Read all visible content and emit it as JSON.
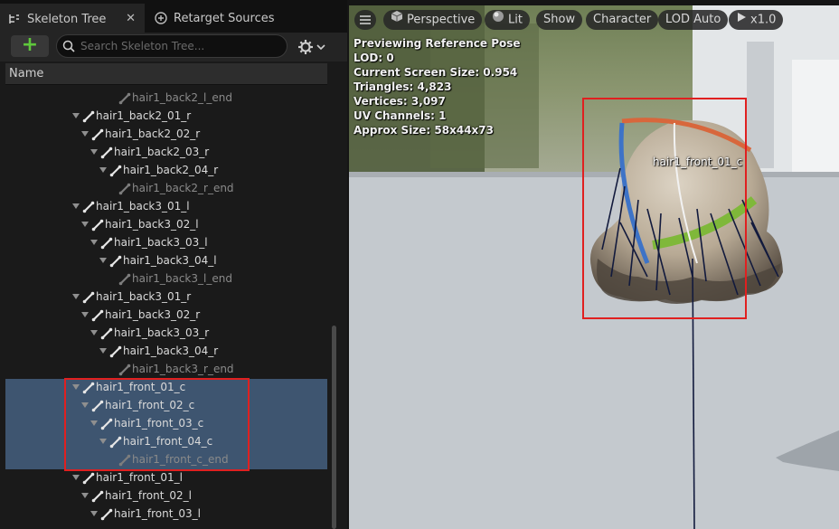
{
  "tabs": [
    {
      "label": "Skeleton Tree",
      "icon": "skeleton-tree-icon",
      "active": true
    },
    {
      "label": "Retarget Sources",
      "icon": "retarget-sources-icon",
      "active": false
    }
  ],
  "toolbar": {
    "add_label": "+",
    "search_placeholder": "Search Skeleton Tree...",
    "search_value": ""
  },
  "tree": {
    "column_header": "Name",
    "rows": [
      {
        "label": "hair1_back2_l_end",
        "depth": 4,
        "leaf": true,
        "selected": false
      },
      {
        "label": "hair1_back2_01_r",
        "depth": 0,
        "leaf": false,
        "selected": false
      },
      {
        "label": "hair1_back2_02_r",
        "depth": 1,
        "leaf": false,
        "selected": false
      },
      {
        "label": "hair1_back2_03_r",
        "depth": 2,
        "leaf": false,
        "selected": false
      },
      {
        "label": "hair1_back2_04_r",
        "depth": 3,
        "leaf": false,
        "selected": false
      },
      {
        "label": "hair1_back2_r_end",
        "depth": 4,
        "leaf": true,
        "selected": false
      },
      {
        "label": "hair1_back3_01_l",
        "depth": 0,
        "leaf": false,
        "selected": false
      },
      {
        "label": "hair1_back3_02_l",
        "depth": 1,
        "leaf": false,
        "selected": false
      },
      {
        "label": "hair1_back3_03_l",
        "depth": 2,
        "leaf": false,
        "selected": false
      },
      {
        "label": "hair1_back3_04_l",
        "depth": 3,
        "leaf": false,
        "selected": false
      },
      {
        "label": "hair1_back3_l_end",
        "depth": 4,
        "leaf": true,
        "selected": false
      },
      {
        "label": "hair1_back3_01_r",
        "depth": 0,
        "leaf": false,
        "selected": false
      },
      {
        "label": "hair1_back3_02_r",
        "depth": 1,
        "leaf": false,
        "selected": false
      },
      {
        "label": "hair1_back3_03_r",
        "depth": 2,
        "leaf": false,
        "selected": false
      },
      {
        "label": "hair1_back3_04_r",
        "depth": 3,
        "leaf": false,
        "selected": false
      },
      {
        "label": "hair1_back3_r_end",
        "depth": 4,
        "leaf": true,
        "selected": false
      },
      {
        "label": "hair1_front_01_c",
        "depth": 0,
        "leaf": false,
        "selected": true
      },
      {
        "label": "hair1_front_02_c",
        "depth": 1,
        "leaf": false,
        "selected": true
      },
      {
        "label": "hair1_front_03_c",
        "depth": 2,
        "leaf": false,
        "selected": true
      },
      {
        "label": "hair1_front_04_c",
        "depth": 3,
        "leaf": false,
        "selected": true
      },
      {
        "label": "hair1_front_c_end",
        "depth": 4,
        "leaf": true,
        "selected": true
      },
      {
        "label": "hair1_front_01_l",
        "depth": 0,
        "leaf": false,
        "selected": false
      },
      {
        "label": "hair1_front_02_l",
        "depth": 1,
        "leaf": false,
        "selected": false
      },
      {
        "label": "hair1_front_03_l",
        "depth": 2,
        "leaf": false,
        "selected": false
      }
    ]
  },
  "viewport": {
    "menu_icon": "hamburger-menu-icon",
    "buttons": [
      {
        "label": "Perspective",
        "icon": "cube-icon"
      },
      {
        "label": "Lit",
        "icon": "sphere-icon"
      },
      {
        "label": "Show",
        "icon": ""
      },
      {
        "label": "Character",
        "icon": ""
      },
      {
        "label": "LOD Auto",
        "icon": ""
      },
      {
        "label": "x1.0",
        "icon": "play-icon"
      }
    ],
    "stats": [
      "Previewing Reference Pose",
      "LOD: 0",
      "Current Screen Size: 0.954",
      "Triangles: 4,823",
      "Vertices: 3,097",
      "UV Channels: 1",
      "Approx Size: 58x44x73"
    ],
    "bone_label": "hair1_front_01_c"
  },
  "colors": {
    "selection": "#3e5570",
    "highlight_box": "#e02020",
    "add_green": "#5fc83c"
  }
}
